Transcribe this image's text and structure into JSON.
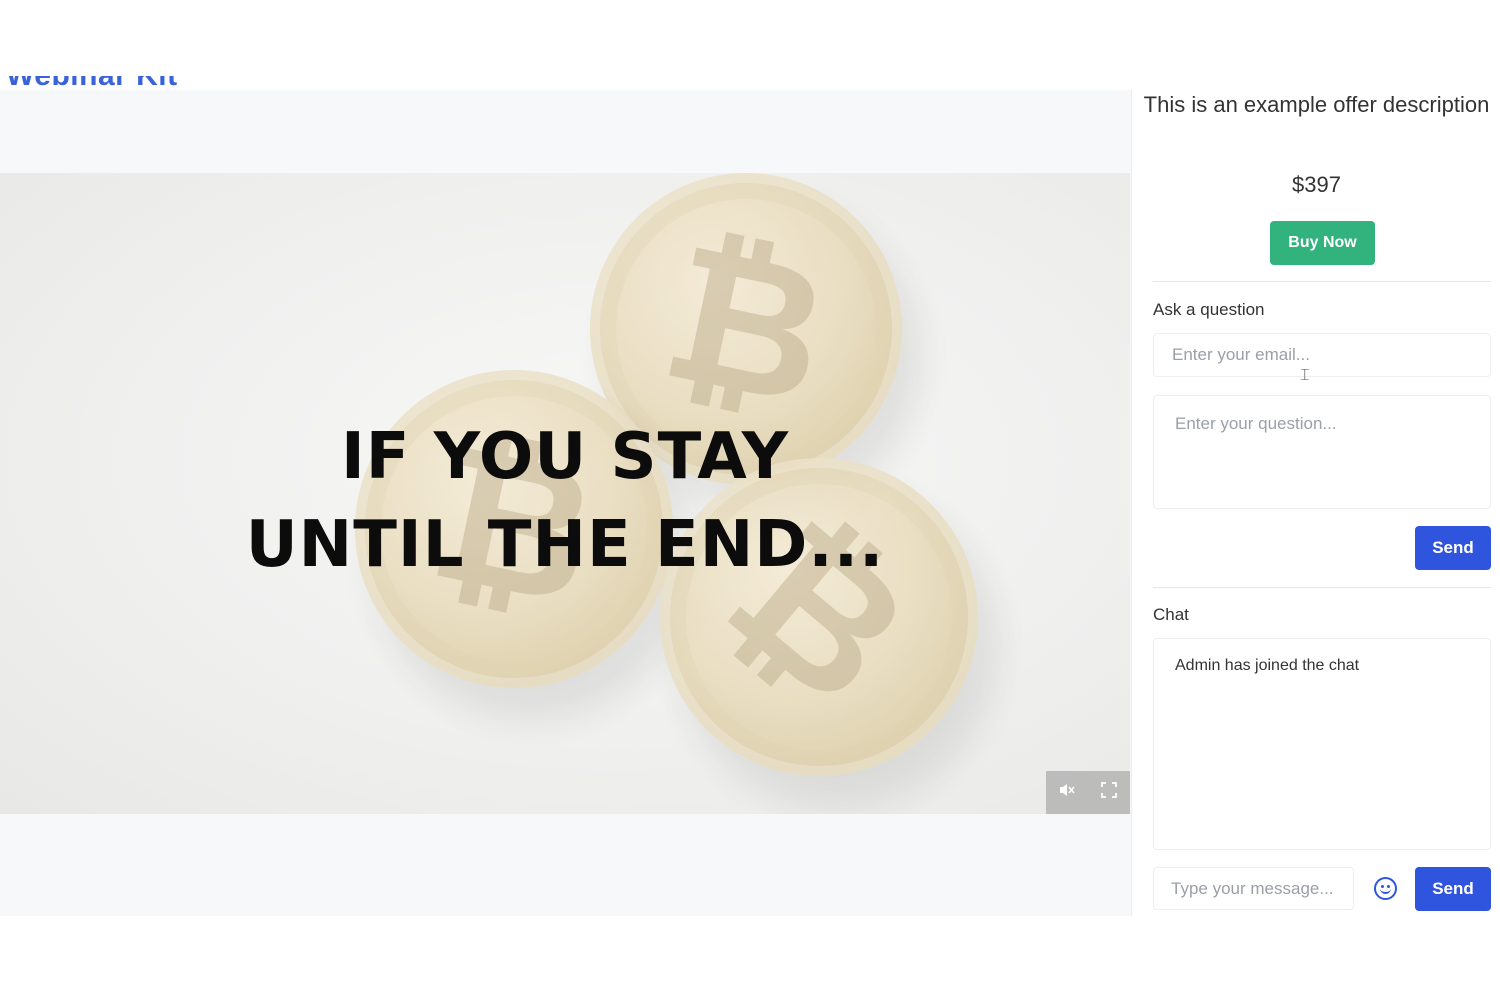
{
  "header": {
    "brand": "Webinar Kit"
  },
  "video": {
    "headline_line1": "IF YOU STAY",
    "headline_line2": "UNTIL THE END...",
    "controls": {
      "mute_icon": "mute-icon",
      "fullscreen_icon": "fullscreen-icon"
    }
  },
  "offer": {
    "description": "This is an example offer description",
    "price": "$397",
    "buy_label": "Buy Now",
    "buy_color": "#32b27d"
  },
  "question_form": {
    "label": "Ask a question",
    "email_placeholder": "Enter your email...",
    "question_placeholder": "Enter your question...",
    "send_label": "Send"
  },
  "chat": {
    "label": "Chat",
    "messages": [
      "Admin has joined the chat"
    ],
    "input_placeholder": "Type your message...",
    "send_label": "Send",
    "accent_color": "#2f55df"
  }
}
